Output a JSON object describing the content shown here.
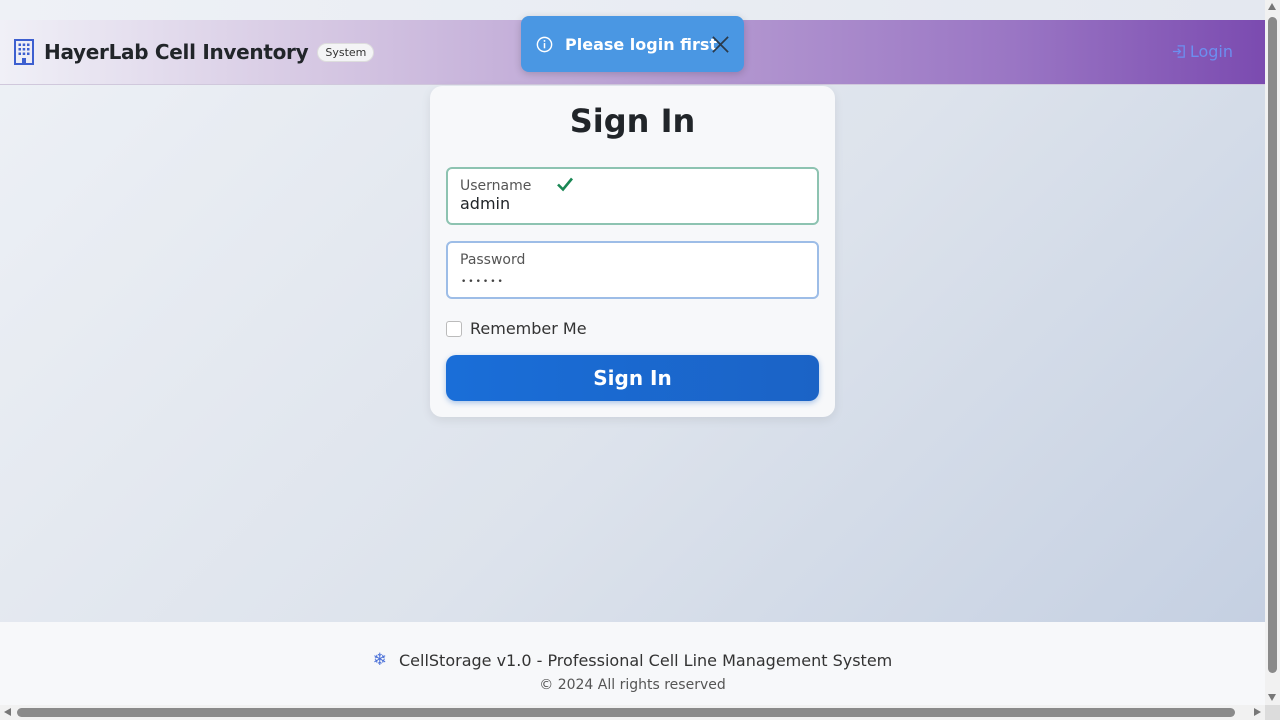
{
  "navbar": {
    "title": "HayerLab Cell Inventory",
    "badge": "System",
    "brand_icon": "building-icon",
    "login_label": "Login",
    "login_icon": "sign-in-icon"
  },
  "toast": {
    "message": "Please login first",
    "icon": "info-circle-icon",
    "close_icon": "close-icon",
    "color": "#4a97e3"
  },
  "login_form": {
    "title": "Sign In",
    "username": {
      "label": "Username",
      "value": "admin",
      "valid": true
    },
    "password": {
      "label": "Password",
      "value_masked": "••••••"
    },
    "remember_label": "Remember Me",
    "remember_checked": false,
    "submit_label": "Sign In",
    "accent_color": "#1b63c6"
  },
  "footer": {
    "line1": "CellStorage v1.0 - Professional Cell Line Management System",
    "line2": "© 2024 All rights reserved",
    "icon": "snowflake-icon"
  }
}
